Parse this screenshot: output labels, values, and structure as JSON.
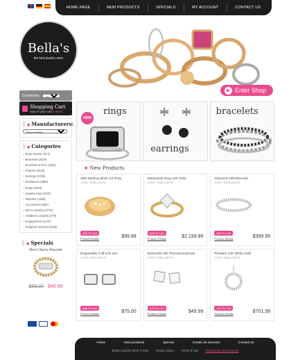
{
  "colors": {
    "accent": "#ea4b8f",
    "dark": "#1d1d1d",
    "grey_panel": "#888888"
  },
  "flags": [
    {
      "name": "uk-flag-icon"
    },
    {
      "name": "germany-flag-icon"
    },
    {
      "name": "spain-flag-icon"
    }
  ],
  "top_nav": [
    {
      "label": "Home page"
    },
    {
      "label": "New products"
    },
    {
      "label": "Specials"
    },
    {
      "label": "My account"
    },
    {
      "label": "Contact us"
    }
  ],
  "logo": {
    "name": "Bella's",
    "tagline": "the best jewelry store"
  },
  "hero": {
    "enter_shop": "Enter Shop"
  },
  "currencies": {
    "label": "Currencies:",
    "selected": "US Dollar"
  },
  "cart": {
    "title": "Shopping Cart",
    "subtitle_prefix": "now in your cart",
    "subtitle_count": "0 items"
  },
  "manufacturers": {
    "title": "Manufacturers:",
    "selected": "Please Select"
  },
  "categories": {
    "title": "Categories",
    "items": [
      "Body Jewelry (674)",
      "Bracelets (2629)",
      "Brooches & Pins (1831)",
      "Charms (3440)",
      "Earrings (3756)",
      "Necklaces (2885)",
      "Rings (4879)",
      "Jewelry Sets (1037)",
      "Watches (1940)",
      "Accessories (861)",
      "Men's Jewelry (2779)",
      "Children's Jewelry (279)",
      "Engagement (1247)",
      "Religious Jewelry (1539)"
    ]
  },
  "specials": {
    "title": "Specials",
    "item_name": "Men's Name Bracelet",
    "old_price": "$58.00",
    "new_price": "$46.99"
  },
  "banners": [
    {
      "label": "rings",
      "badge": "NEW"
    },
    {
      "label": "earrings"
    },
    {
      "label": "bracelets"
    }
  ],
  "new_products": {
    "title": "New Products",
    "add_label": "Add To Cart",
    "details_label": "Product Details",
    "items": [
      {
        "name": "18kt Sterling Silver CZ Ring",
        "code": "CODE: 1DB6.LAB.FB",
        "price": "$99.99",
        "icon": "gold-ring-icon"
      },
      {
        "name": "Moissanite Ring 14K Gold",
        "code": "CODE: 1DB6.LAB.FB",
        "price": "$2,199.99",
        "icon": "diamond-ring-icon"
      },
      {
        "name": "Diamond 18kt Bracelet",
        "code": "CODE: 1DB6.LAB.FB",
        "price": "$399.99",
        "icon": "bracelet-icon"
      },
      {
        "name": "Engravable Cuff Link Set",
        "code": "CODE: 1DB6.LAB.FB",
        "price": "$75.00",
        "icon": "cufflinks-icon"
      },
      {
        "name": "Diamonfd 18k Princess Earrings",
        "code": "CODE: 1DB6.LAB.FB",
        "price": "$49.99",
        "icon": "earrings-icon"
      },
      {
        "name": "Pendant 14K White Gold",
        "code": "CODE: 1DB6.LAB.FB",
        "price": "$701.99",
        "icon": "pendant-icon"
      }
    ]
  },
  "footer": {
    "links": [
      "Home",
      "New products",
      "Special",
      "Create an account",
      "Contact us"
    ],
    "copyright": "Bella's Jewelry Store © 2011",
    "privacy": "Privacy Notice",
    "terms": "Terms of Use",
    "powered": "Powered by osCommerce"
  },
  "payments": [
    "paypal-icon",
    "visa-icon",
    "mastercard-icon"
  ]
}
